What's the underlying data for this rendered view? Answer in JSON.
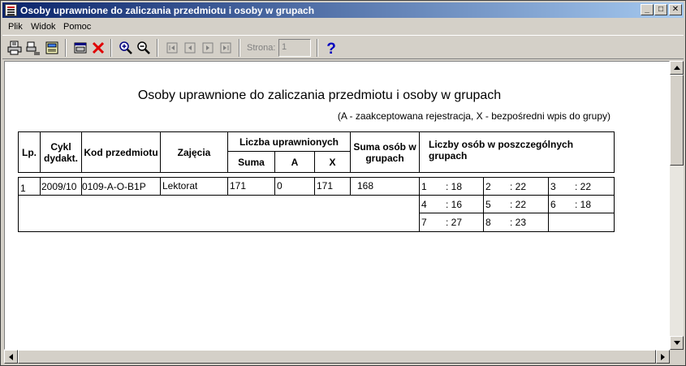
{
  "window": {
    "title": "Osoby uprawnione do zaliczania przedmiotu i osoby w grupach",
    "min_glyph": "_",
    "max_glyph": "□",
    "close_glyph": "✕"
  },
  "menu": [
    "Plik",
    "Widok",
    "Pomoc"
  ],
  "toolbar": {
    "page_label": "Strona:",
    "page_value": "1"
  },
  "report": {
    "title": "Osoby uprawnione do zaliczania przedmiotu i osoby w grupach",
    "subtitle": "(A - zaakceptowana rejestracja, X - bezpośredni wpis do grupy)",
    "headers": {
      "lp": "Lp.",
      "cykl": "Cykl dydakt.",
      "kod": "Kod przedmiotu",
      "zajecia": "Zajęcia",
      "liczba_uprawnionych": "Liczba uprawnionych",
      "suma": "Suma",
      "a": "A",
      "x": "X",
      "suma_osob": "Suma osób w grupach",
      "liczby_osob": "Liczby osób w poszczególnych grupach"
    },
    "row": {
      "lp": "1",
      "cykl": "2009/10",
      "kod": "0109-A-O-B1P",
      "zajecia": "Lektorat",
      "suma": "171",
      "a": "0",
      "x": "171",
      "suma_osob": "168"
    },
    "groups": [
      {
        "num": "1",
        "count": ": 18"
      },
      {
        "num": "2",
        "count": ": 22"
      },
      {
        "num": "3",
        "count": ": 22"
      },
      {
        "num": "4",
        "count": ": 16"
      },
      {
        "num": "5",
        "count": ": 22"
      },
      {
        "num": "6",
        "count": ": 18"
      },
      {
        "num": "7",
        "count": ": 27"
      },
      {
        "num": "8",
        "count": ": 23"
      }
    ]
  },
  "colors": {
    "titlebar_start": "#0a246a",
    "titlebar_end": "#a6caf0",
    "chrome": "#d4d0c8",
    "delete_red": "#e00000",
    "help_blue": "#0000c0"
  }
}
